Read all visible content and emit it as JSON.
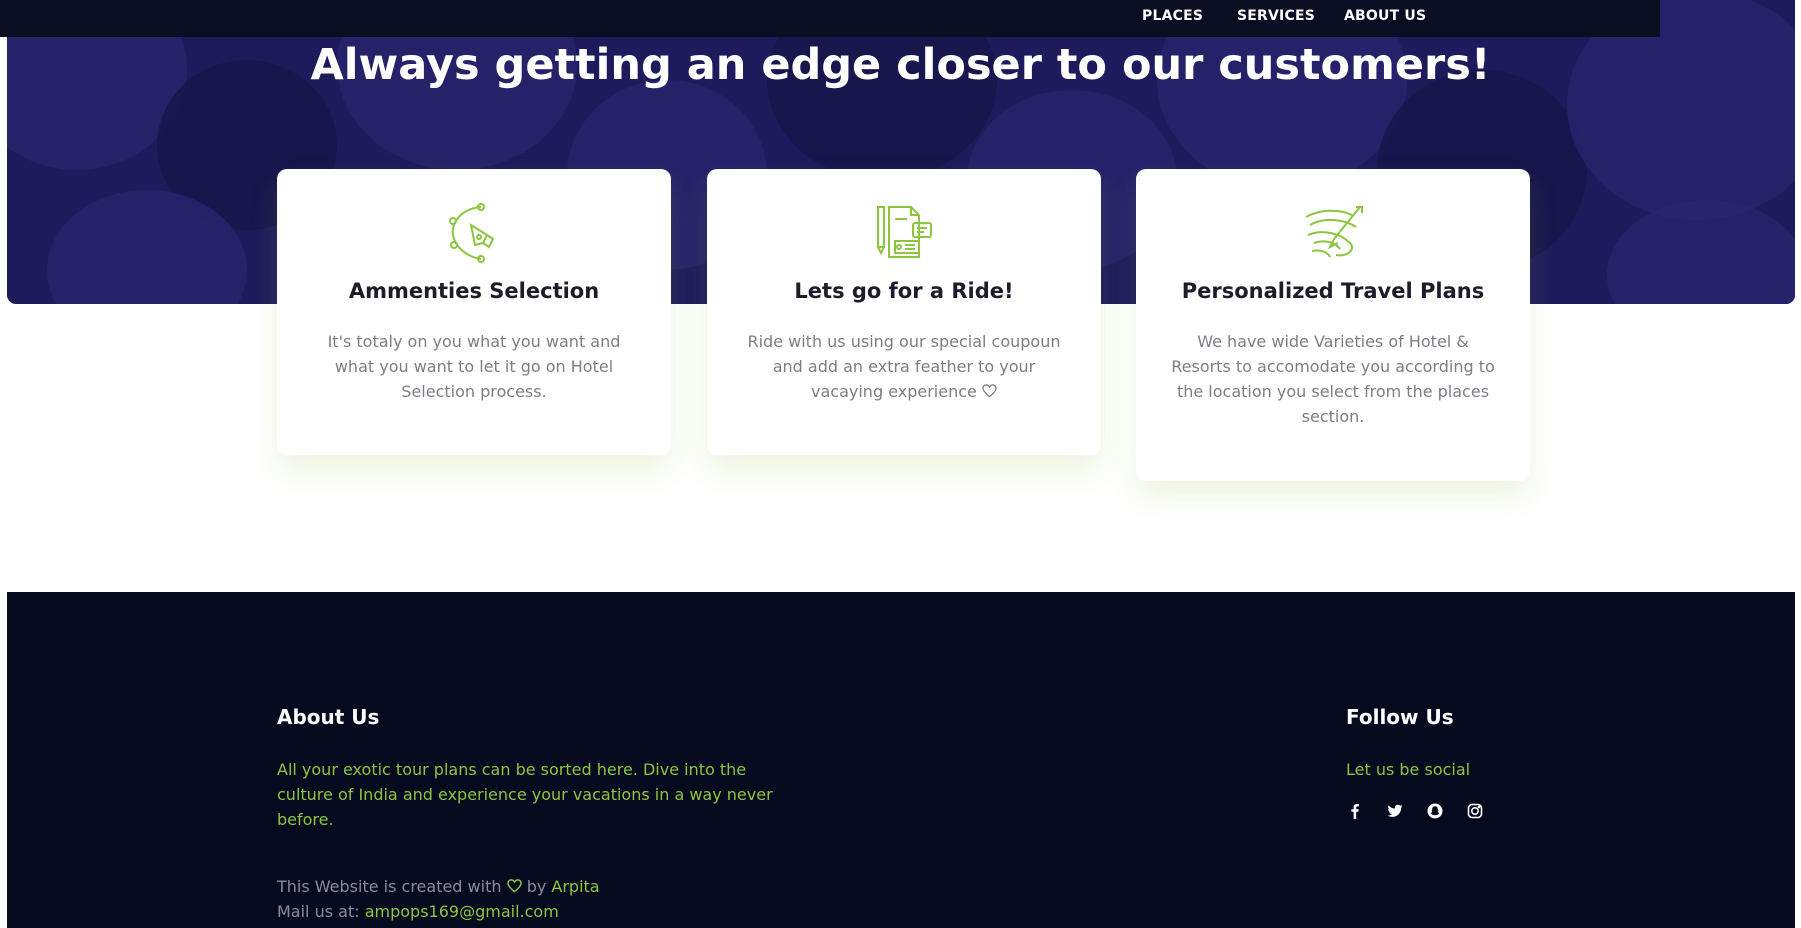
{
  "nav": {
    "links": [
      "PLACES",
      "SERVICES",
      "ABOUT US"
    ]
  },
  "hero": {
    "title": "Always getting an edge closer to our customers!"
  },
  "cards": [
    {
      "icon": "pen-tool-icon",
      "title": "Ammenties Selection",
      "text": "It's totaly on you what you want and what you want to let it go on Hotel Selection process."
    },
    {
      "icon": "ticket-document-icon",
      "title": "Lets go for a Ride!",
      "text": "Ride with us using our special coupoun and add an extra feather to your vacaying experience",
      "trailing_icon": "heart-icon"
    },
    {
      "icon": "travel-swirl-icon",
      "title": "Personalized Travel Plans",
      "text": "We have wide Varieties of Hotel & Resorts to accomodate you according to the location you select from the places section."
    }
  ],
  "footer": {
    "about": {
      "heading": "About Us",
      "text": "All your exotic tour plans can be sorted here. Dive into the culture of India and experience your vacations in a way never before."
    },
    "follow": {
      "heading": "Follow Us",
      "text": "Let us be social",
      "icons": [
        "facebook-icon",
        "twitter-icon",
        "snapchat-icon",
        "instagram-icon"
      ]
    },
    "credit": {
      "prefix": "This Website is created with",
      "by": "by",
      "author": "Arpita",
      "mail_label": "Mail us at:",
      "email": "ampops169@gmail.com"
    }
  },
  "colors": {
    "accent": "#8cc63f",
    "hero_bg": "#1d1b5c",
    "navbar_bg": "#0b0d22",
    "footer_bg": "#050a1e"
  }
}
